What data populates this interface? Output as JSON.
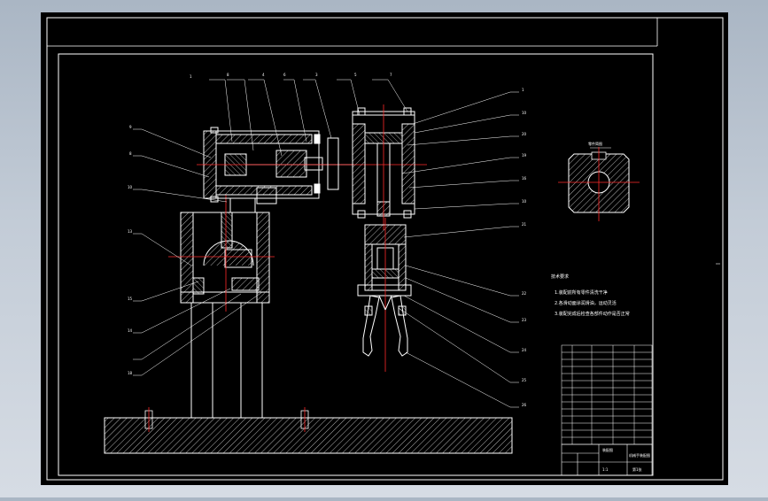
{
  "balloons": {
    "top": [
      "1",
      "8",
      "4",
      "6",
      "3",
      "5",
      "7"
    ],
    "left": [
      "9",
      "8",
      "10",
      "13",
      "15",
      "14",
      "18"
    ],
    "right": [
      "1",
      "10",
      "20",
      "19",
      "16",
      "10",
      "21",
      "22",
      "23",
      "24",
      "25",
      "26",
      "27"
    ]
  },
  "section": {
    "label": "零件简图"
  },
  "notes": {
    "heading": "技术要求",
    "lines": [
      "1.装配前所有零件清洗干净",
      "2.各滑动面涂润滑油，运动灵活",
      "3.装配完成后检查各部件动作是否正常"
    ]
  },
  "titleblock": {
    "name": "机械手装配图",
    "drawing_no": "装配图",
    "scale": "1:1",
    "sheet": "第1张"
  },
  "colors": {
    "paper": "#000000",
    "line": "#ffffff",
    "center": "#ff2a2a",
    "hatch": "#ffffff"
  }
}
